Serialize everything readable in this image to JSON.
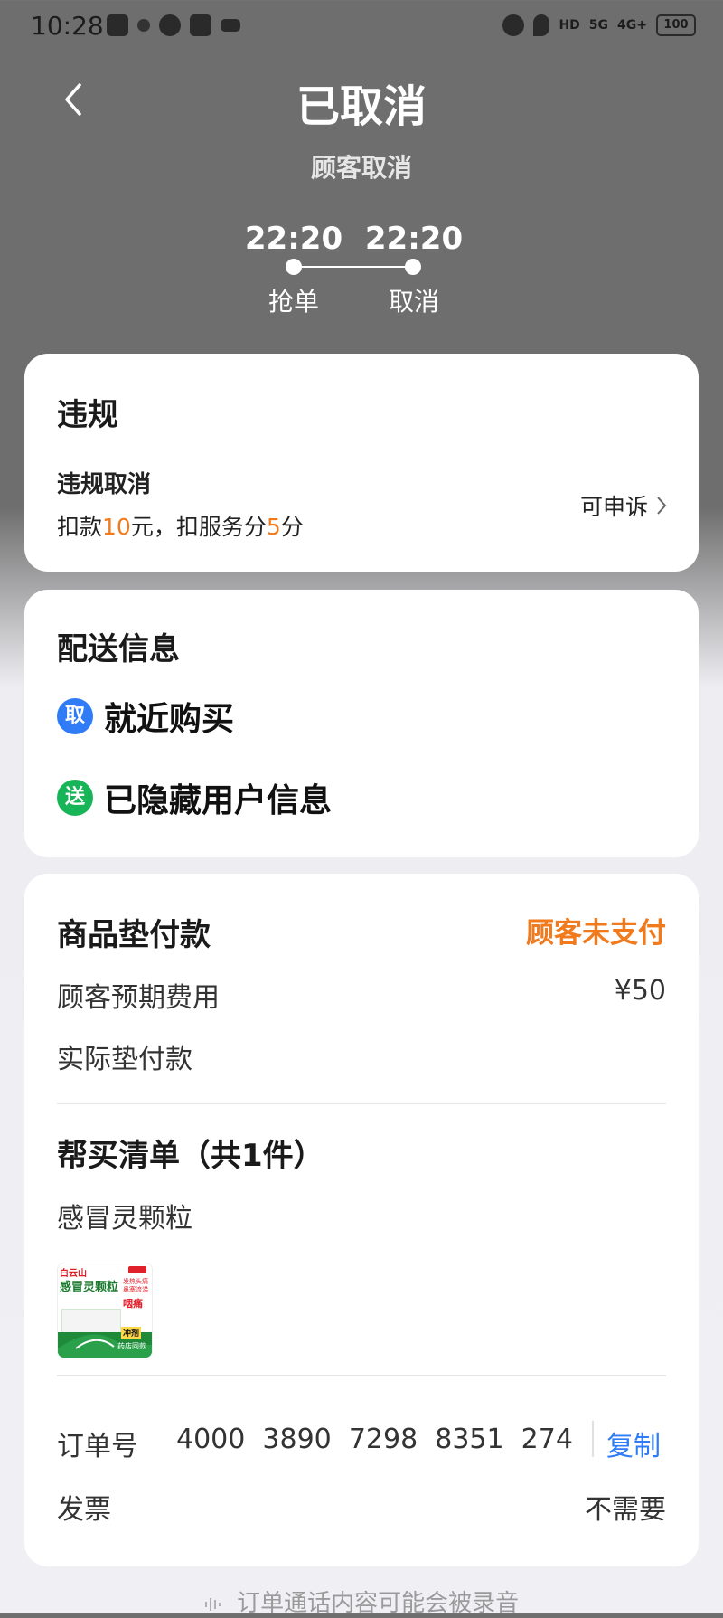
{
  "status_bar": {
    "time": "10:28",
    "battery": "100",
    "network_1": "5G",
    "network_2": "4G+",
    "hd": "HD"
  },
  "header": {
    "title": "已取消",
    "subtitle": "顾客取消"
  },
  "timeline": {
    "steps": [
      {
        "time": "22:20",
        "label": "抢单"
      },
      {
        "time": "22:20",
        "label": "取消"
      }
    ]
  },
  "violation": {
    "title": "违规",
    "type": "违规取消",
    "detail_prefix": "扣款",
    "deduct_amount": "10",
    "detail_middle": "元，扣服务分",
    "deduct_score": "5",
    "detail_suffix": "分",
    "appeal_label": "可申诉"
  },
  "delivery": {
    "title": "配送信息",
    "pickup_badge": "取",
    "pickup_text": "就近购买",
    "deliver_badge": "送",
    "deliver_text": "已隐藏用户信息"
  },
  "goods": {
    "title": "商品垫付款",
    "payment_status": "顾客未支付",
    "expected_label": "顾客预期费用",
    "expected_value": "¥50",
    "actual_label": "实际垫付款",
    "list_title": "帮买清单（共1件）",
    "item_name": "感冒灵颗粒",
    "product_image_text": {
      "brand": "白云山",
      "name": "感冒灵颗粒",
      "tag1": "发热头痛",
      "tag2": "鼻塞流涕",
      "tag3": "咽痛",
      "type": "冲剂",
      "note": "药店同款"
    },
    "order_label": "订单号",
    "order_number": "4000  3890  7298  8351  274",
    "copy_label": "复制",
    "invoice_label": "发票",
    "invoice_value": "不需要"
  },
  "footer": {
    "note": "订单通话内容可能会被录音"
  },
  "colors": {
    "accent_orange": "#f07a1c",
    "link_blue": "#2f7cf6",
    "badge_green": "#18b458"
  }
}
